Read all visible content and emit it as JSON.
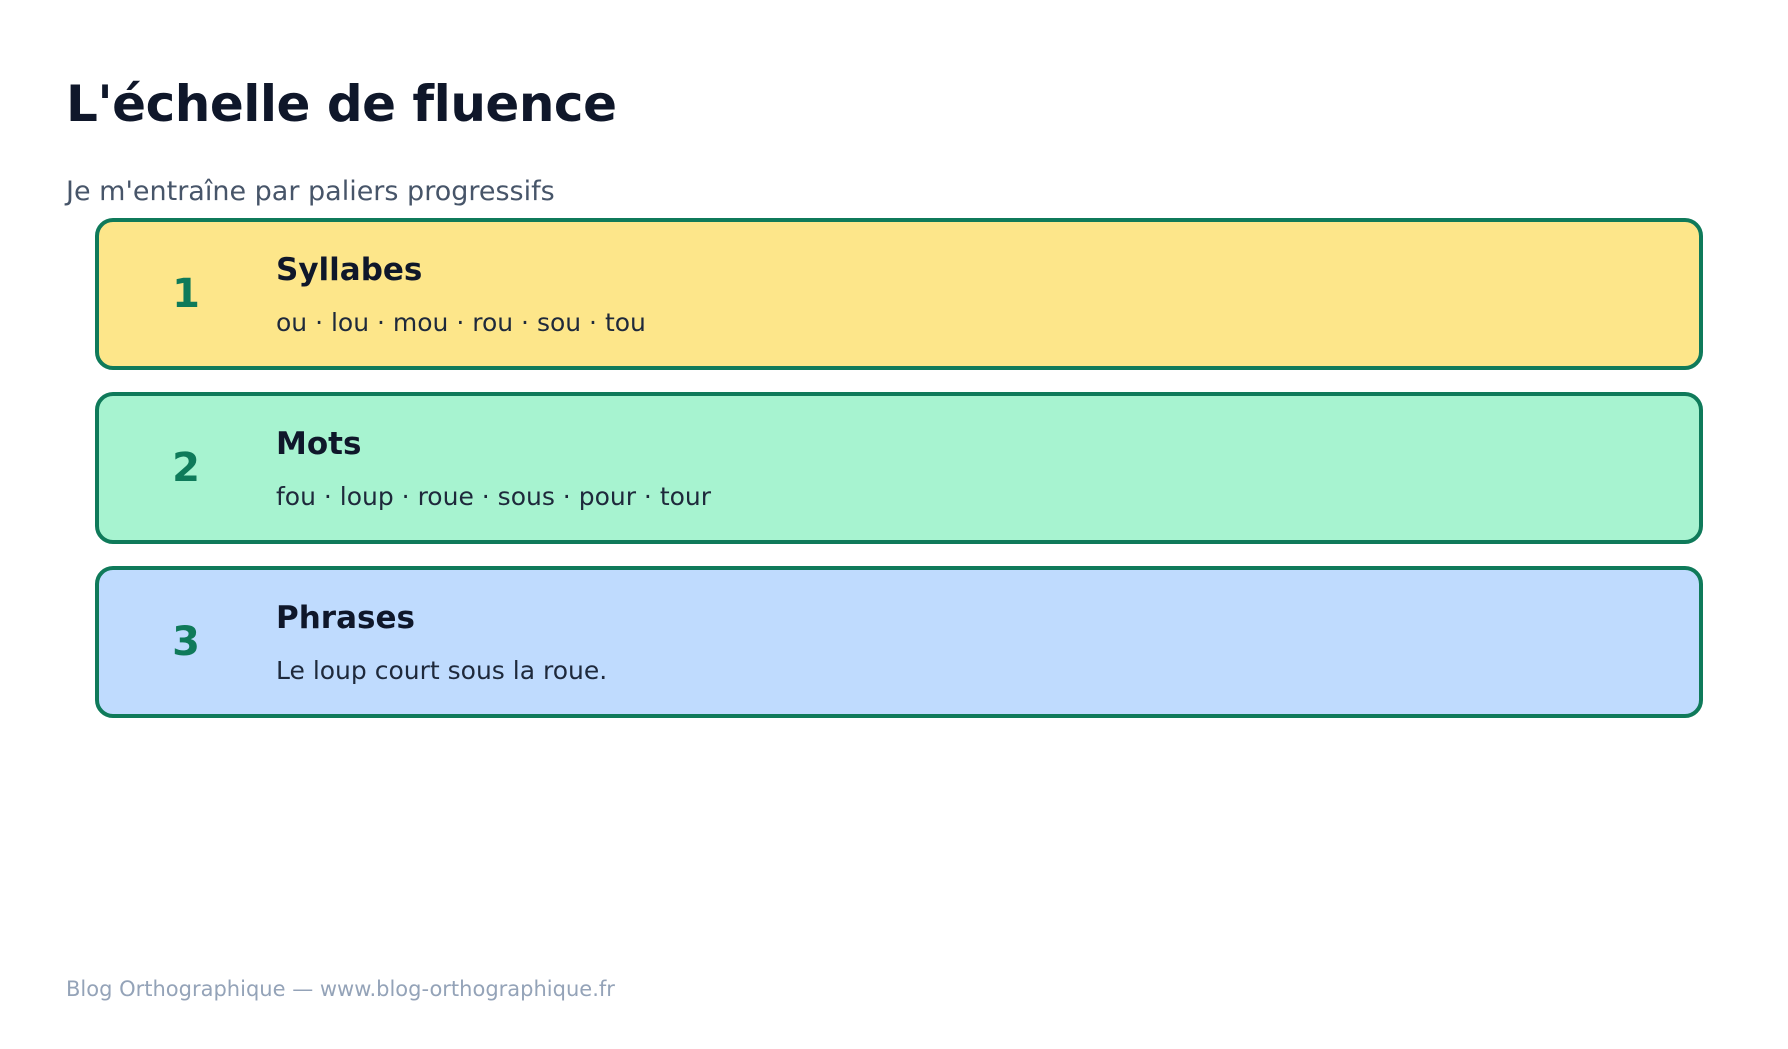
{
  "title": "L'échelle de fluence",
  "subtitle": "Je m'entraîne par paliers progressifs",
  "levels": [
    {
      "number": "1",
      "title": "Syllabes",
      "content": "ou · lou · mou · rou · sou · tou",
      "color": "#fde68a"
    },
    {
      "number": "2",
      "title": "Mots",
      "content": "fou · loup · roue · sous · pour · tour",
      "color": "#a7f3d0"
    },
    {
      "number": "3",
      "title": "Phrases",
      "content": "Le loup court sous la roue.",
      "color": "#bfdbfe"
    }
  ],
  "colors": {
    "border": "#0f7a5a",
    "number": "#0f7a5a"
  },
  "footer": "Blog Orthographique — www.blog-orthographique.fr"
}
